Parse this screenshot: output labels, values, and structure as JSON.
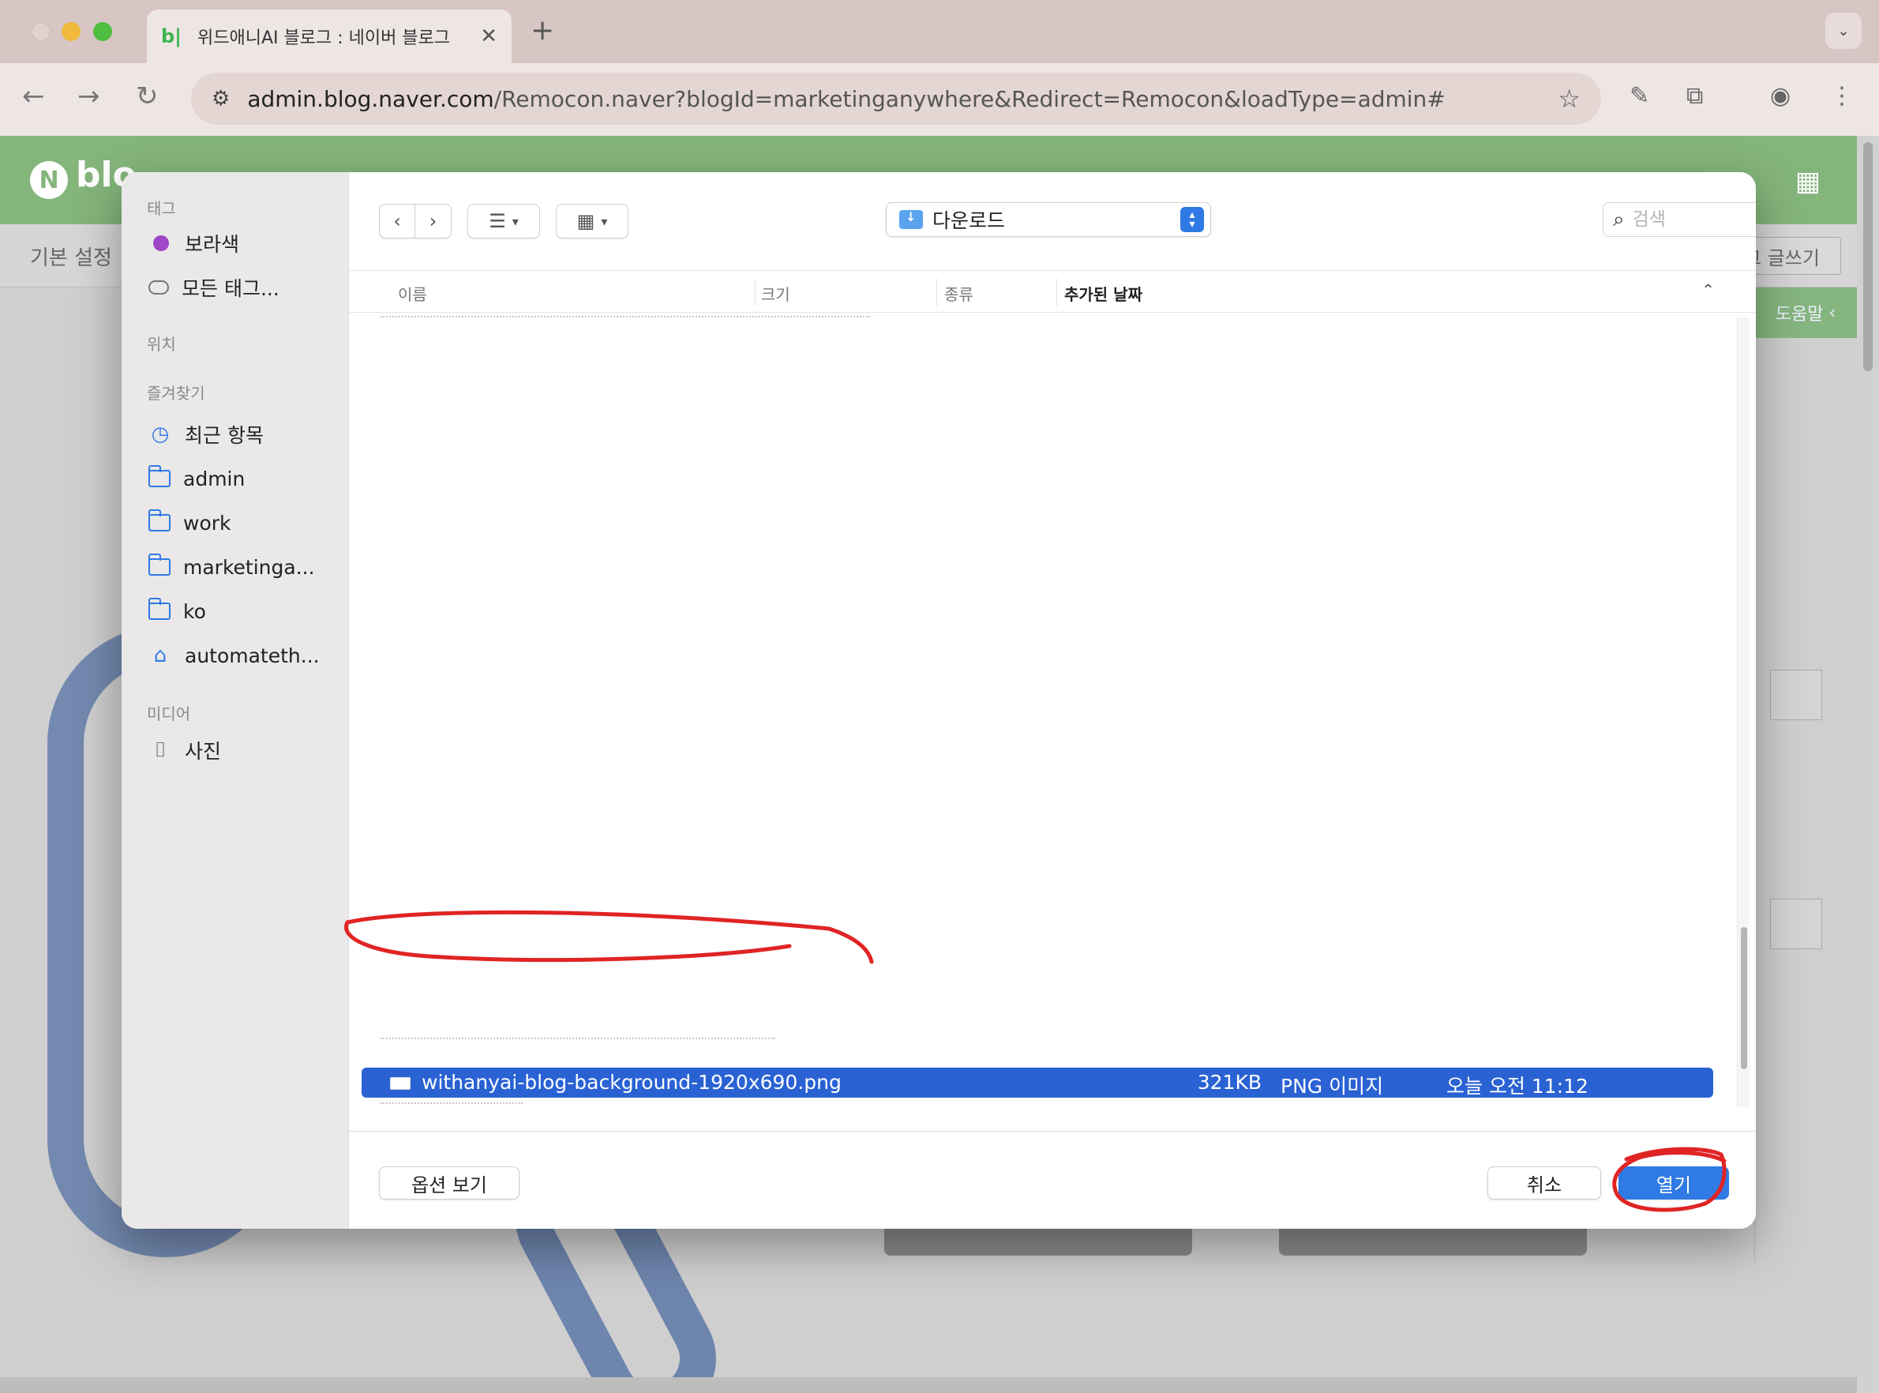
{
  "browser": {
    "tab_title": "위드애니AI 블로그 : 네이버 블로그",
    "tab_favicon": "b|",
    "url_host": "admin.blog.naver.com",
    "url_path": "/Remocon.naver?blogId=marketinganywhere&Redirect=Remocon&loadType=admin#"
  },
  "page": {
    "logo_letter": "N",
    "logo_text": "blo",
    "subnav_label": "기본 설정",
    "write_button": "그 글쓰기",
    "help_tab": "도움말"
  },
  "dialog": {
    "sidebar": {
      "section_tags": "태그",
      "tags": [
        "보라색",
        "모든 태그..."
      ],
      "section_locations": "위치",
      "section_favorites": "즐겨찾기",
      "favorites": [
        "최근 항목",
        "admin",
        "work",
        "marketinga...",
        "ko",
        "automateth..."
      ],
      "section_media": "미디어",
      "media": [
        "사진"
      ]
    },
    "location": "다운로드",
    "search_placeholder": "검색",
    "columns": {
      "name": "이름",
      "size": "크기",
      "kind": "종류",
      "date_added": "추가된 날짜"
    },
    "selected_file": {
      "name": "withanyai-blog-background-1920x690.png",
      "size": "321KB",
      "kind": "PNG 이미지",
      "date_added": "오늘 오전 11:12"
    },
    "buttons": {
      "options": "옵션 보기",
      "cancel": "취소",
      "open": "열기"
    }
  },
  "colors": {
    "accent": "#2f7ae5",
    "selection": "#2a62d4",
    "annotation": "#e02424",
    "naver_green": "#84b57b"
  }
}
